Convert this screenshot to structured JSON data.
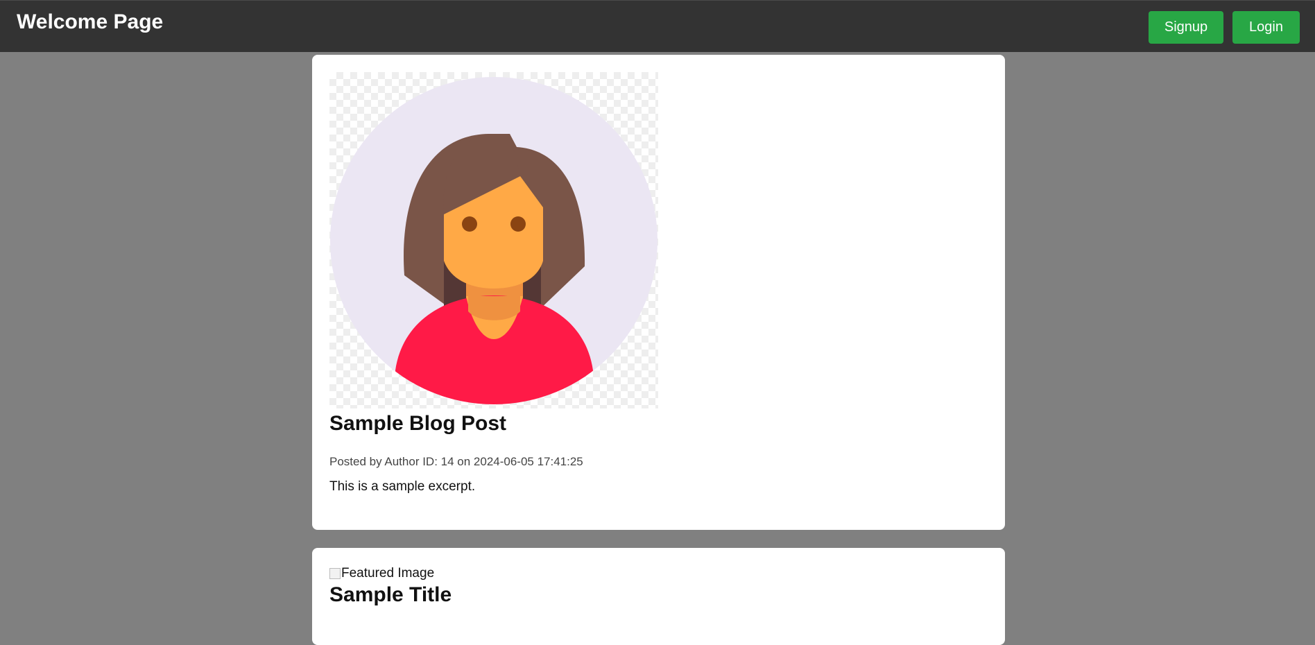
{
  "header": {
    "title": "Welcome Page",
    "signup_label": "Signup",
    "login_label": "Login"
  },
  "posts": [
    {
      "title": "Sample Blog Post",
      "meta": "Posted by Author ID: 14 on 2024-06-05 17:41:25",
      "excerpt": "This is a sample excerpt.",
      "image": "woman-avatar-illustration"
    },
    {
      "image_alt": "Featured Image",
      "title": "Sample Title"
    }
  ],
  "colors": {
    "header_bg": "#333333",
    "page_bg": "#808080",
    "button_green": "#28a745",
    "avatar_bg": "#ebe6f3",
    "hair": "#7a5548",
    "skin": "#ffa946",
    "shirt": "#ff1a47"
  }
}
